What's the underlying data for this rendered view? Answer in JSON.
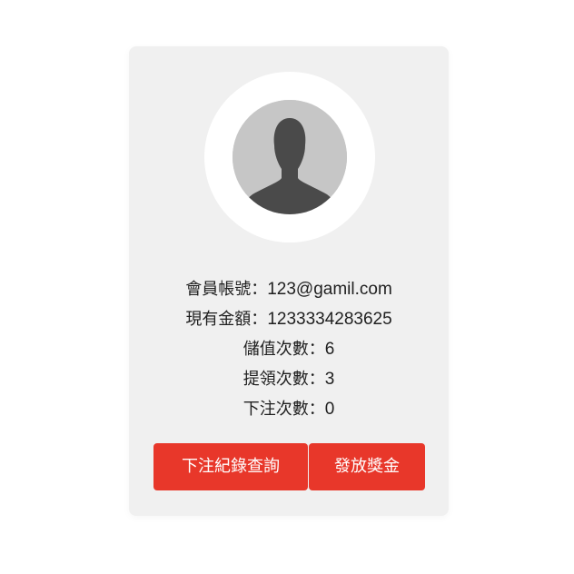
{
  "profile": {
    "account_label": "會員帳號：",
    "account_value": "123@gamil.com",
    "balance_label": "現有金額：",
    "balance_value": "1233334283625",
    "deposit_label": "儲值次數：",
    "deposit_value": "6",
    "withdraw_label": "提領次數：",
    "withdraw_value": "3",
    "bet_label": "下注次數：",
    "bet_value": "0"
  },
  "actions": {
    "records_label": "下注紀錄查詢",
    "bonus_label": "發放獎金"
  },
  "colors": {
    "card_bg": "#f0f0f0",
    "button_bg": "#e8372a",
    "button_text": "#ffffff",
    "avatar_bg": "#c6c6c6",
    "avatar_silhouette": "#4a4a4a"
  },
  "icons": {
    "avatar": "user-silhouette-icon"
  }
}
